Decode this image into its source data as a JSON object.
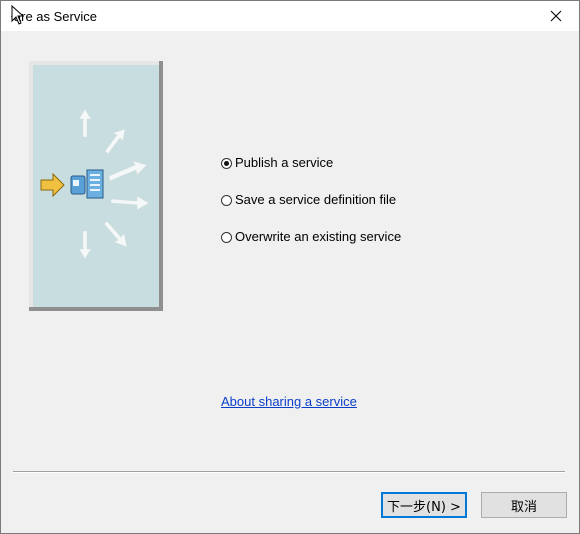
{
  "window": {
    "title": "Share as Service",
    "title_visible": "ƚare as Service"
  },
  "options": [
    {
      "label": "Publish a service",
      "selected": true
    },
    {
      "label": "Save a service definition file",
      "selected": false
    },
    {
      "label": "Overwrite an existing service",
      "selected": false
    }
  ],
  "links": {
    "about": "About sharing a service"
  },
  "buttons": {
    "next": "下一步(N) >",
    "cancel": "取消"
  },
  "colors": {
    "accent": "#0078d7",
    "link": "#0a3ec8",
    "illustration_bg": "#c8dde0",
    "arrow_input": "#f0c040"
  }
}
